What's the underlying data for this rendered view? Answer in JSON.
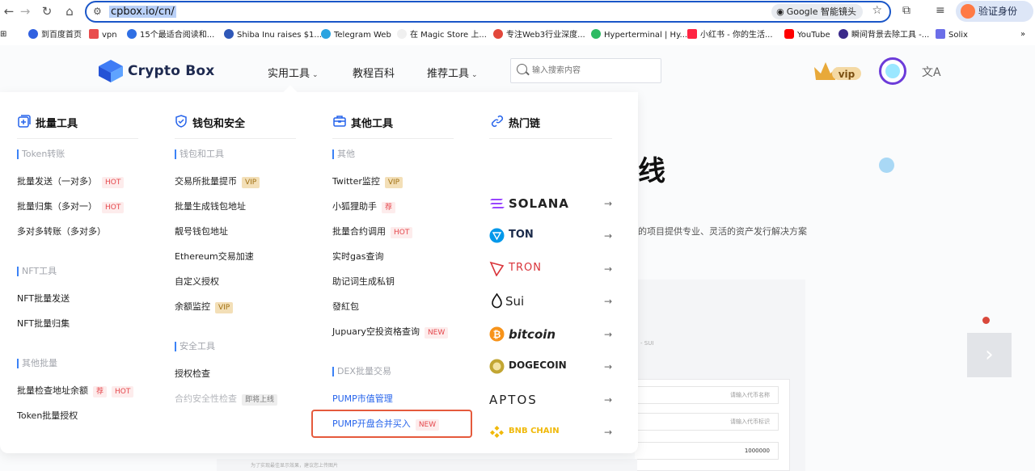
{
  "browser": {
    "url": "cpbox.io/cn/",
    "lens_label": "Google 智能镜头",
    "profile_label": "验证身份",
    "bookmarks": [
      "到百度首页",
      "vpn",
      "15个最适合阅读和...",
      "Shiba Inu raises $1...",
      "Telegram Web",
      "在 Magic Store 上...",
      "专注Web3行业深度...",
      "Hyperterminal | Hy...",
      "小红书 - 你的生活...",
      "YouTube",
      "瞬间背景去除工具 -...",
      "Solix"
    ]
  },
  "header": {
    "brand": "Crypto Box",
    "menu": [
      "实用工具",
      "教程百科",
      "推荐工具"
    ],
    "search_placeholder": "输入搜索内容",
    "vip_label": "vip",
    "lang_icon": "translate-icon"
  },
  "hero": {
    "title_fragment": "线",
    "subtitle_fragment": "的项目提供专业、灵活的资产发行解决方案",
    "sui_note": "- SUI",
    "form_fields": [
      "请输入代币名称",
      "请输入代币标识",
      "1000000"
    ],
    "upload_note": "为了实现最佳显示效果，建议您上传图片"
  },
  "dropdown": {
    "batch": {
      "title": "批量工具",
      "sections": [
        {
          "name": "Token转账",
          "items": [
            {
              "label": "批量发送（一对多）",
              "badges": [
                "HOT"
              ]
            },
            {
              "label": "批量归集（多对一）",
              "badges": [
                "HOT"
              ]
            },
            {
              "label": "多对多转账（多对多）",
              "badges": []
            }
          ]
        },
        {
          "name": "NFT工具",
          "items": [
            {
              "label": "NFT批量发送",
              "badges": []
            },
            {
              "label": "NFT批量归集",
              "badges": []
            }
          ]
        },
        {
          "name": "其他批量",
          "items": [
            {
              "label": "批量检查地址余额",
              "badges": [
                "荐",
                "HOT"
              ]
            },
            {
              "label": "Token批量授权",
              "badges": []
            }
          ]
        }
      ]
    },
    "wallet": {
      "title": "钱包和安全",
      "sections": [
        {
          "name": "钱包和工具",
          "items": [
            {
              "label": "交易所批量提币",
              "badges": [
                "VIP"
              ]
            },
            {
              "label": "批量生成钱包地址",
              "badges": []
            },
            {
              "label": "靓号钱包地址",
              "badges": []
            },
            {
              "label": "Ethereum交易加速",
              "badges": []
            },
            {
              "label": "自定义授权",
              "badges": []
            },
            {
              "label": "余额监控",
              "badges": [
                "VIP"
              ]
            }
          ]
        },
        {
          "name": "安全工具",
          "items": [
            {
              "label": "授权检查",
              "badges": []
            },
            {
              "label": "合约安全性检查",
              "badges": [
                "即将上线"
              ]
            }
          ]
        }
      ]
    },
    "other": {
      "title": "其他工具",
      "sections": [
        {
          "name": "其他",
          "items": [
            {
              "label": "Twitter监控",
              "badges": [
                "VIP"
              ]
            },
            {
              "label": "小狐狸助手",
              "badges": [
                "荐"
              ]
            },
            {
              "label": "批量合约调用",
              "badges": [
                "HOT"
              ]
            },
            {
              "label": "实时gas查询",
              "badges": []
            },
            {
              "label": "助记词生成私钥",
              "badges": []
            },
            {
              "label": "發紅包",
              "badges": []
            },
            {
              "label": "Jupuary空投资格查询",
              "badges": [
                "NEW"
              ]
            }
          ]
        },
        {
          "name": "DEX批量交易",
          "items": [
            {
              "label": "PUMP市值管理",
              "badges": []
            },
            {
              "label": "PUMP开盘合并买入",
              "badges": [
                "NEW"
              ]
            }
          ]
        }
      ]
    },
    "chains": {
      "title": "热门链",
      "items": [
        {
          "name": "SOLANA",
          "color": "#111111",
          "icon_color": "#9945ff"
        },
        {
          "name": "TON",
          "color": "#1a2a4a",
          "icon_color": "#0098ea"
        },
        {
          "name": "TRON",
          "color": "#d9343a",
          "icon_color": "#d9343a"
        },
        {
          "name": "Sui",
          "color": "#111111",
          "icon_color": "#111111"
        },
        {
          "name": "bitcoin",
          "color": "#111111",
          "icon_color": "#f7931a"
        },
        {
          "name": "DOGECOIN",
          "color": "#111111",
          "icon_color": "#c2a633"
        },
        {
          "name": "APTOS",
          "color": "#111111",
          "icon_color": "#111111"
        },
        {
          "name": "BNB CHAIN",
          "color": "#f0b90b",
          "icon_color": "#f0b90b"
        }
      ]
    }
  }
}
